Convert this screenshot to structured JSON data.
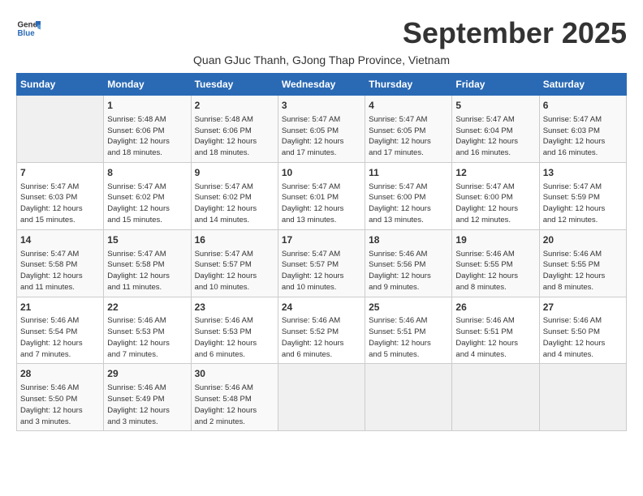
{
  "header": {
    "logo_general": "General",
    "logo_blue": "Blue",
    "month_title": "September 2025",
    "subtitle": "Quan GJuc Thanh, GJong Thap Province, Vietnam"
  },
  "days_of_week": [
    "Sunday",
    "Monday",
    "Tuesday",
    "Wednesday",
    "Thursday",
    "Friday",
    "Saturday"
  ],
  "weeks": [
    [
      {
        "day": "",
        "info": ""
      },
      {
        "day": "1",
        "info": "Sunrise: 5:48 AM\nSunset: 6:06 PM\nDaylight: 12 hours\nand 18 minutes."
      },
      {
        "day": "2",
        "info": "Sunrise: 5:48 AM\nSunset: 6:06 PM\nDaylight: 12 hours\nand 18 minutes."
      },
      {
        "day": "3",
        "info": "Sunrise: 5:47 AM\nSunset: 6:05 PM\nDaylight: 12 hours\nand 17 minutes."
      },
      {
        "day": "4",
        "info": "Sunrise: 5:47 AM\nSunset: 6:05 PM\nDaylight: 12 hours\nand 17 minutes."
      },
      {
        "day": "5",
        "info": "Sunrise: 5:47 AM\nSunset: 6:04 PM\nDaylight: 12 hours\nand 16 minutes."
      },
      {
        "day": "6",
        "info": "Sunrise: 5:47 AM\nSunset: 6:03 PM\nDaylight: 12 hours\nand 16 minutes."
      }
    ],
    [
      {
        "day": "7",
        "info": "Sunrise: 5:47 AM\nSunset: 6:03 PM\nDaylight: 12 hours\nand 15 minutes."
      },
      {
        "day": "8",
        "info": "Sunrise: 5:47 AM\nSunset: 6:02 PM\nDaylight: 12 hours\nand 15 minutes."
      },
      {
        "day": "9",
        "info": "Sunrise: 5:47 AM\nSunset: 6:02 PM\nDaylight: 12 hours\nand 14 minutes."
      },
      {
        "day": "10",
        "info": "Sunrise: 5:47 AM\nSunset: 6:01 PM\nDaylight: 12 hours\nand 13 minutes."
      },
      {
        "day": "11",
        "info": "Sunrise: 5:47 AM\nSunset: 6:00 PM\nDaylight: 12 hours\nand 13 minutes."
      },
      {
        "day": "12",
        "info": "Sunrise: 5:47 AM\nSunset: 6:00 PM\nDaylight: 12 hours\nand 12 minutes."
      },
      {
        "day": "13",
        "info": "Sunrise: 5:47 AM\nSunset: 5:59 PM\nDaylight: 12 hours\nand 12 minutes."
      }
    ],
    [
      {
        "day": "14",
        "info": "Sunrise: 5:47 AM\nSunset: 5:58 PM\nDaylight: 12 hours\nand 11 minutes."
      },
      {
        "day": "15",
        "info": "Sunrise: 5:47 AM\nSunset: 5:58 PM\nDaylight: 12 hours\nand 11 minutes."
      },
      {
        "day": "16",
        "info": "Sunrise: 5:47 AM\nSunset: 5:57 PM\nDaylight: 12 hours\nand 10 minutes."
      },
      {
        "day": "17",
        "info": "Sunrise: 5:47 AM\nSunset: 5:57 PM\nDaylight: 12 hours\nand 10 minutes."
      },
      {
        "day": "18",
        "info": "Sunrise: 5:46 AM\nSunset: 5:56 PM\nDaylight: 12 hours\nand 9 minutes."
      },
      {
        "day": "19",
        "info": "Sunrise: 5:46 AM\nSunset: 5:55 PM\nDaylight: 12 hours\nand 8 minutes."
      },
      {
        "day": "20",
        "info": "Sunrise: 5:46 AM\nSunset: 5:55 PM\nDaylight: 12 hours\nand 8 minutes."
      }
    ],
    [
      {
        "day": "21",
        "info": "Sunrise: 5:46 AM\nSunset: 5:54 PM\nDaylight: 12 hours\nand 7 minutes."
      },
      {
        "day": "22",
        "info": "Sunrise: 5:46 AM\nSunset: 5:53 PM\nDaylight: 12 hours\nand 7 minutes."
      },
      {
        "day": "23",
        "info": "Sunrise: 5:46 AM\nSunset: 5:53 PM\nDaylight: 12 hours\nand 6 minutes."
      },
      {
        "day": "24",
        "info": "Sunrise: 5:46 AM\nSunset: 5:52 PM\nDaylight: 12 hours\nand 6 minutes."
      },
      {
        "day": "25",
        "info": "Sunrise: 5:46 AM\nSunset: 5:51 PM\nDaylight: 12 hours\nand 5 minutes."
      },
      {
        "day": "26",
        "info": "Sunrise: 5:46 AM\nSunset: 5:51 PM\nDaylight: 12 hours\nand 4 minutes."
      },
      {
        "day": "27",
        "info": "Sunrise: 5:46 AM\nSunset: 5:50 PM\nDaylight: 12 hours\nand 4 minutes."
      }
    ],
    [
      {
        "day": "28",
        "info": "Sunrise: 5:46 AM\nSunset: 5:50 PM\nDaylight: 12 hours\nand 3 minutes."
      },
      {
        "day": "29",
        "info": "Sunrise: 5:46 AM\nSunset: 5:49 PM\nDaylight: 12 hours\nand 3 minutes."
      },
      {
        "day": "30",
        "info": "Sunrise: 5:46 AM\nSunset: 5:48 PM\nDaylight: 12 hours\nand 2 minutes."
      },
      {
        "day": "",
        "info": ""
      },
      {
        "day": "",
        "info": ""
      },
      {
        "day": "",
        "info": ""
      },
      {
        "day": "",
        "info": ""
      }
    ]
  ]
}
